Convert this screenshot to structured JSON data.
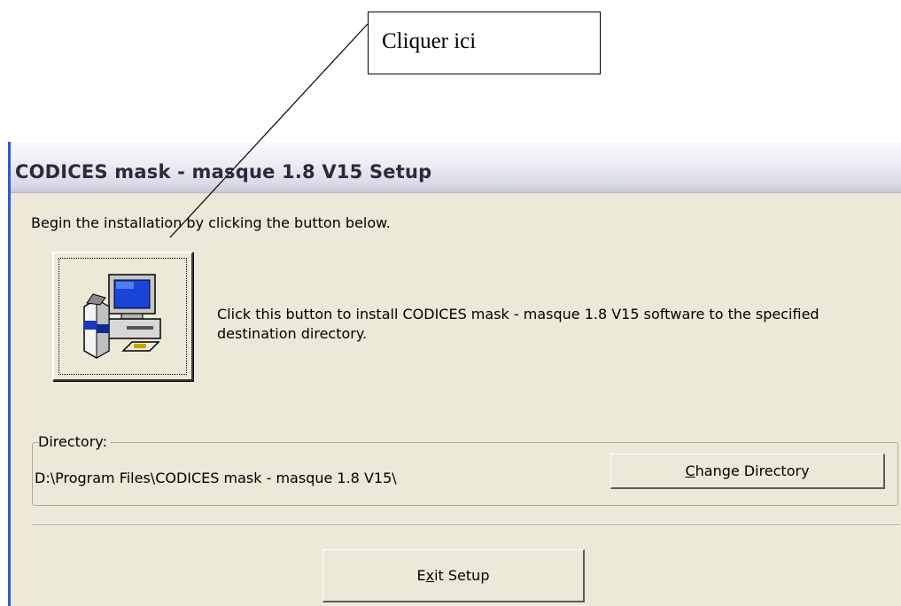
{
  "callout": {
    "text": "Cliquer ici"
  },
  "dialog": {
    "title": "CODICES mask - masque 1.8 V15 Setup",
    "intro": "Begin the installation by clicking the button below.",
    "install_button": {
      "icon": "installer-computer-icon"
    },
    "install_description": "Click this button to install CODICES mask - masque 1.8 V15 software to the specified destination directory.",
    "directory": {
      "legend": "Directory:",
      "path": "D:\\Program Files\\CODICES mask - masque 1.8 V15\\",
      "change_button": {
        "mnemonic": "C",
        "rest": "hange Directory"
      }
    },
    "exit_button": {
      "before": "E",
      "mnemonic": "x",
      "after": "it Setup"
    }
  }
}
